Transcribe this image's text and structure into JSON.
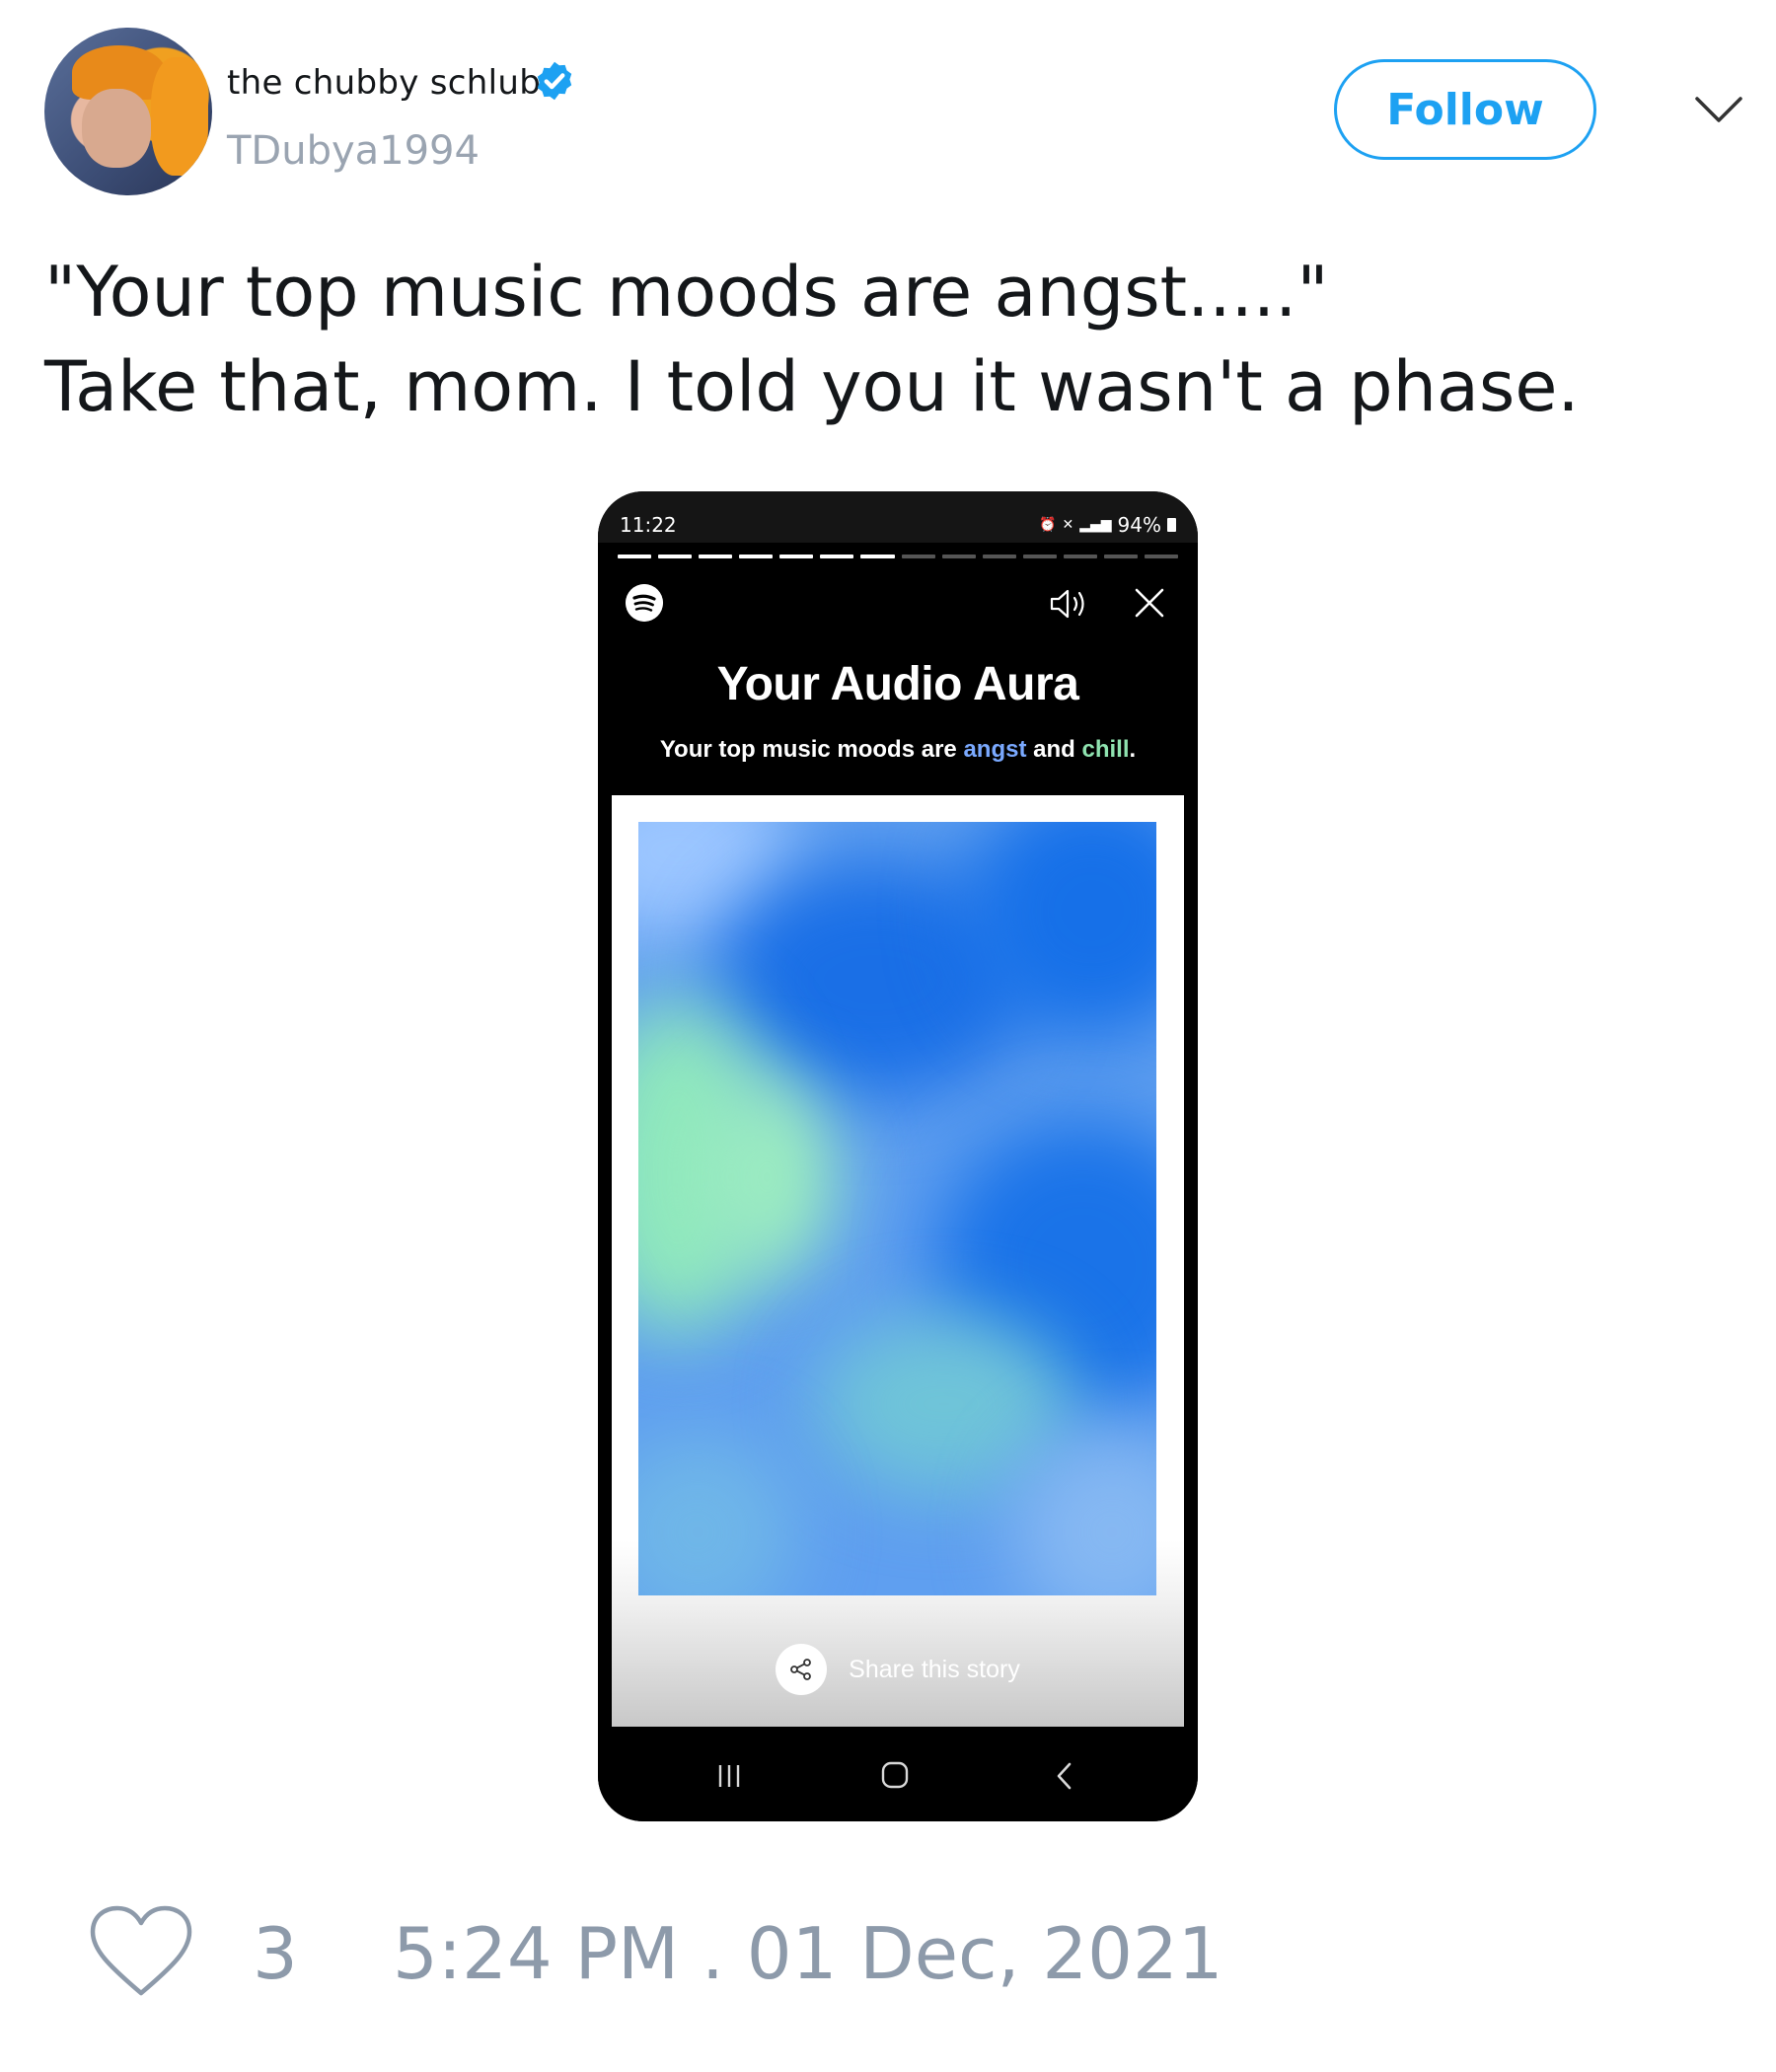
{
  "tweet": {
    "author_name": "the chubby schlubb",
    "handle": "TDubya1994",
    "follow_label": "Follow",
    "text_lines": [
      "\"Your top music moods are angst.....\"",
      "Take that, mom. I told you it wasn't a phase."
    ],
    "like_count": "3",
    "timestamp": "5:24 PM . 01 Dec, 2021"
  },
  "phone": {
    "status_time": "11:22",
    "battery": "94%",
    "story_progress": {
      "segments": 14,
      "completed": 7
    },
    "title": "Your Audio Aura",
    "subtitle": {
      "prefix": "Your top music moods are ",
      "mood1": "angst",
      "middle": " and ",
      "mood2": "chill",
      "suffix": "."
    },
    "share_label": "Share this story"
  },
  "colors": {
    "accent_blue": "#1da1f2",
    "muted_gray": "#8d9aaa",
    "mood_angst": "#7aa9ff",
    "mood_chill": "#8fe3b0"
  },
  "icons": [
    "verified-badge-icon",
    "chevron-down-icon",
    "spotify-logo-icon",
    "speaker-icon",
    "close-icon",
    "share-icon",
    "nav-recents-icon",
    "nav-home-icon",
    "nav-back-icon",
    "heart-icon"
  ]
}
